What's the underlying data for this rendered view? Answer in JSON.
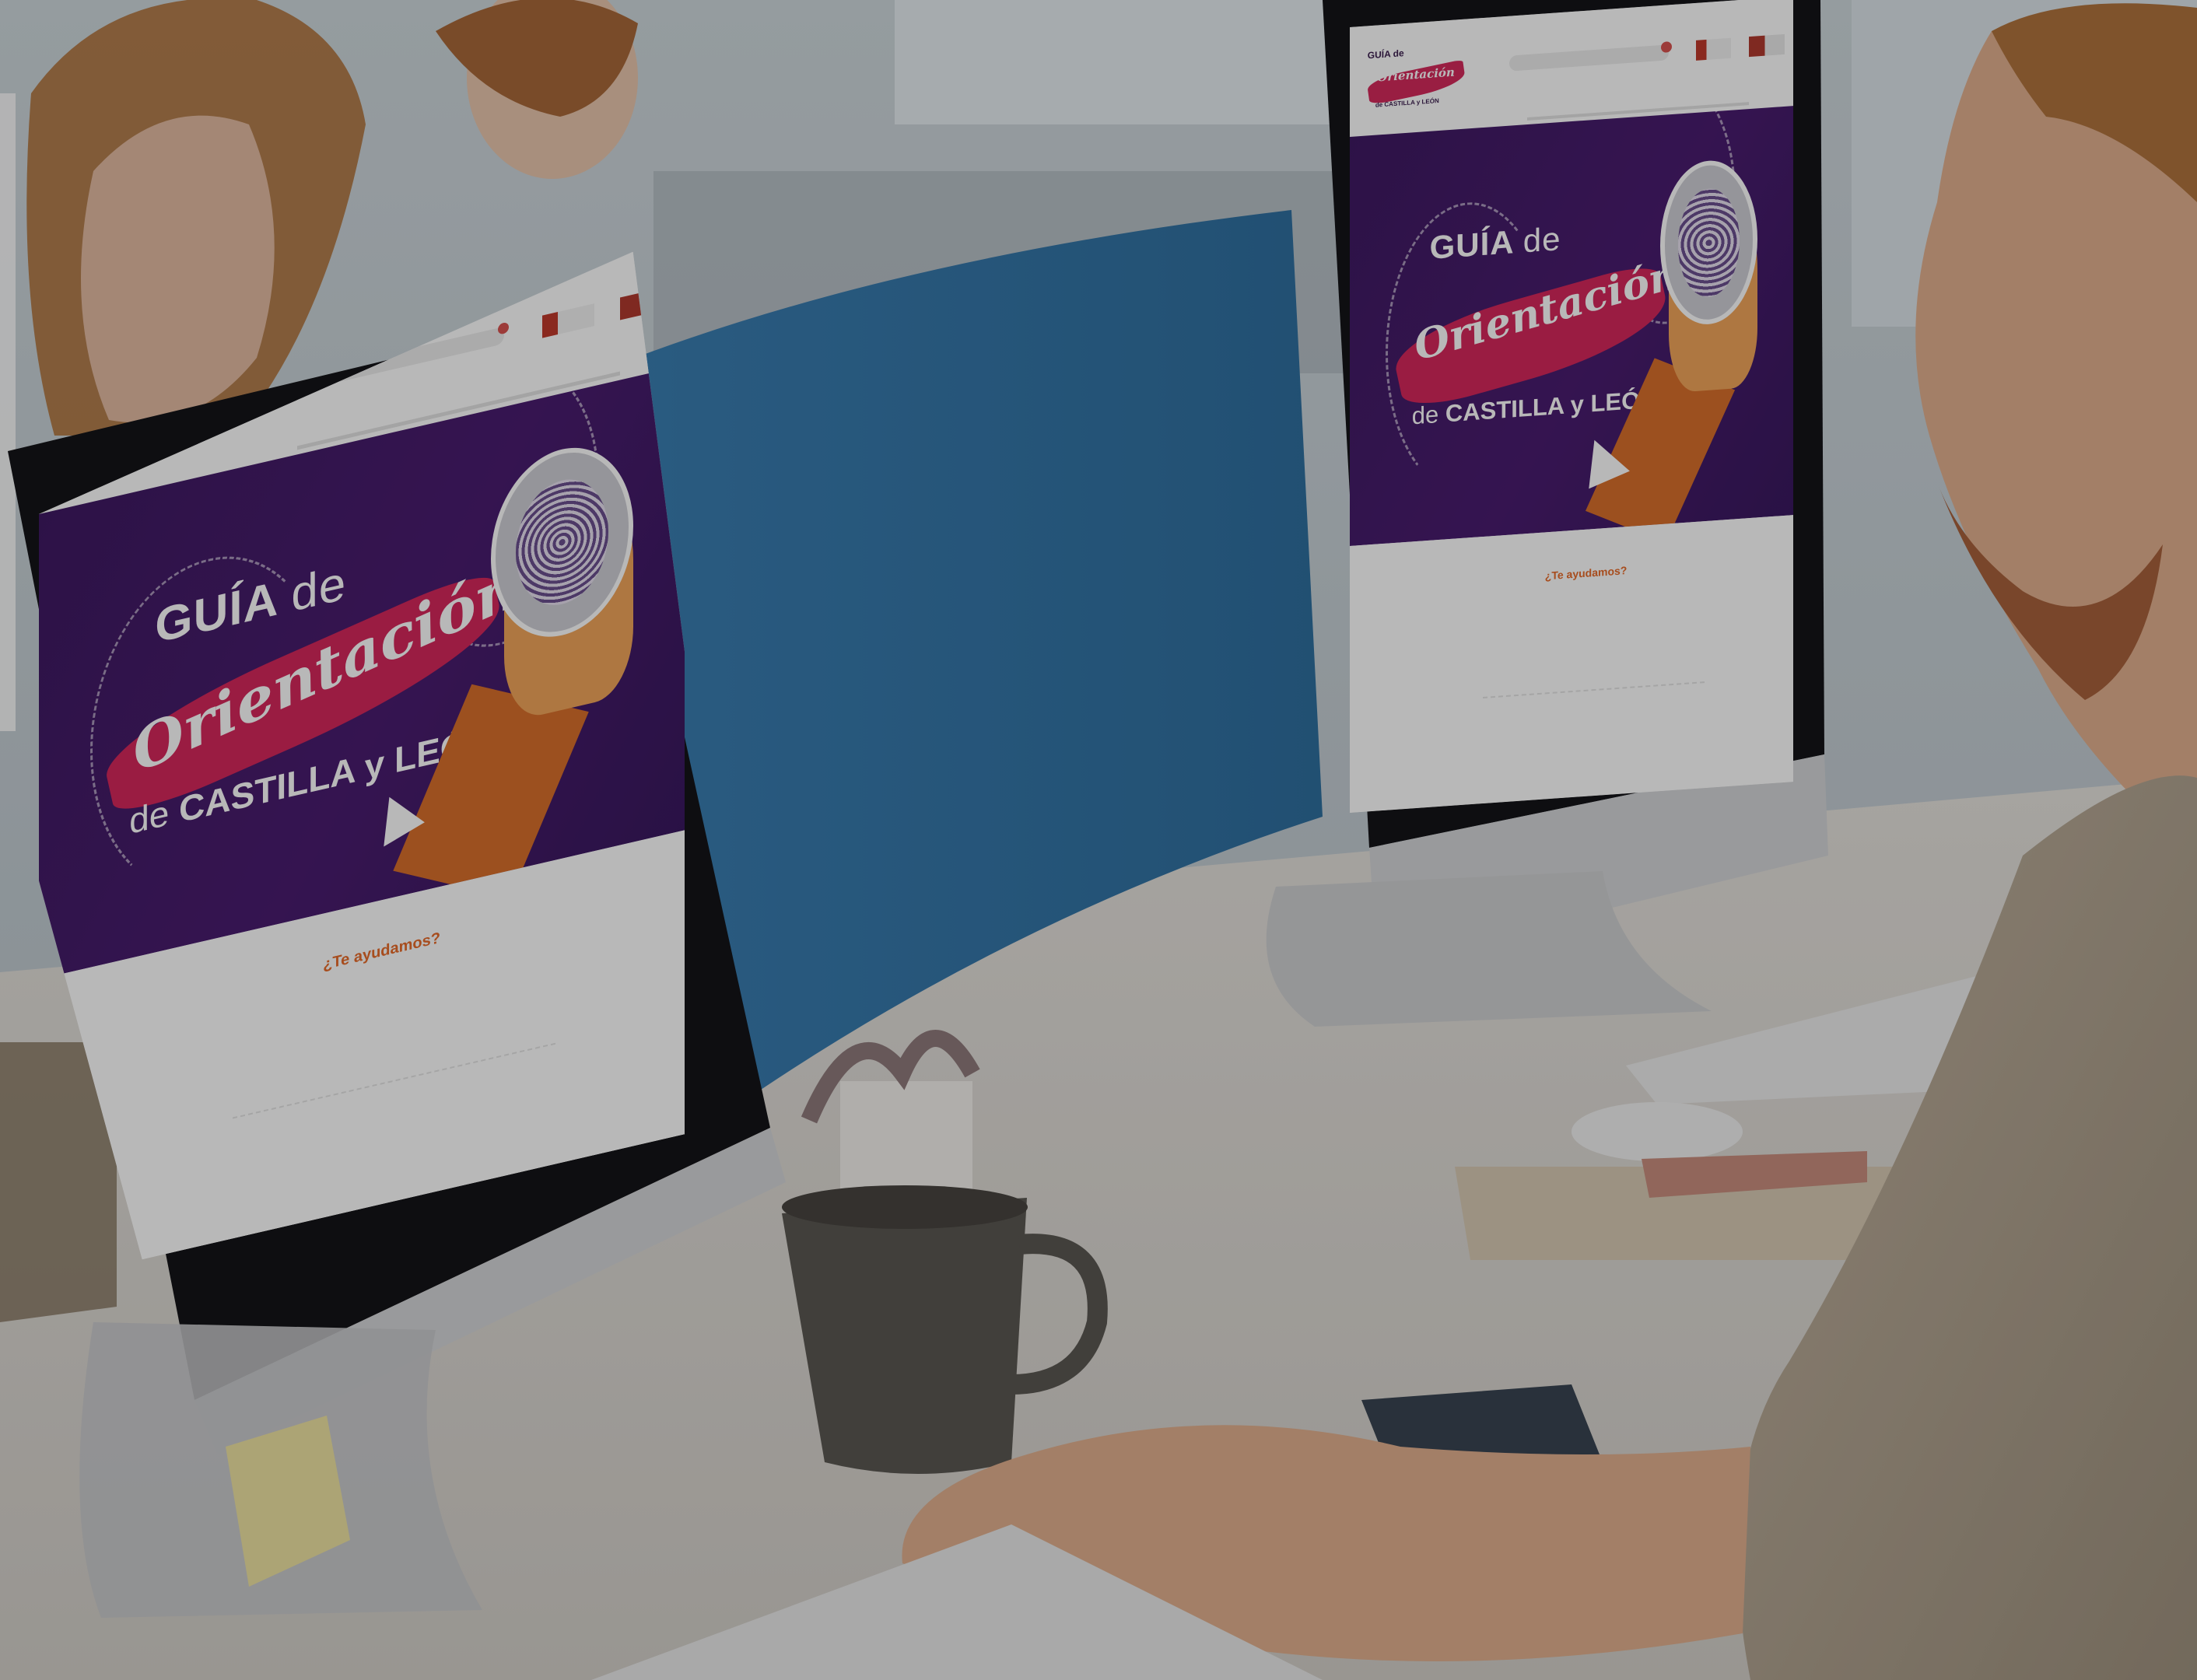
{
  "photo": {
    "colors": {
      "wall": "#c9d2d8",
      "window": "#e8eef2",
      "desk": "#e9e6e1",
      "divider_panel": "#3f87ba",
      "monitor_bezel": "#17171b",
      "monitor_body": "#d9dadc",
      "mug": "#5b5853",
      "skin": "#e2b08f",
      "beard": "#a8623c",
      "hair": "#b0743e",
      "sweater": "#b8a996",
      "sticky_note": "#efe4a3"
    }
  },
  "site": {
    "logo": {
      "top_word": "GUÍA de",
      "script_word": "Orientación",
      "region": "de CASTILLA y LEÓN"
    },
    "hero": {
      "title_bold": "GUÍA",
      "title_light": "de",
      "script": "Orientación",
      "region_light": "de",
      "region_bold": "CASTILLA y LEÓN"
    },
    "cta": "¿Te ayudamos?",
    "colors": {
      "purple": "#47206b",
      "magenta": "#d6285c",
      "orange": "#e86b2a",
      "white": "#ffffff"
    }
  }
}
